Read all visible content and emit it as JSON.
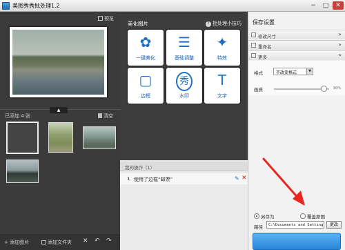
{
  "window": {
    "title": "美图秀秀批处理1.2",
    "min": "−",
    "max": "□",
    "close": "✕"
  },
  "left": {
    "preview_label": "预览",
    "collapse_glyph": "▲",
    "added_count_label": "已添加 4 张",
    "clear_label": "清空",
    "footer": {
      "add_image": "添加图片",
      "add_folder": "添加文件夹",
      "delete_glyph": "✕",
      "undo_glyph": "↶",
      "redo_glyph": "↷"
    }
  },
  "center": {
    "title": "美化图片",
    "tips_label": "批处理小技巧",
    "tips_icon": "?",
    "tiles": [
      {
        "label": "一键美化",
        "glyph": "✿",
        "icon": "flower-icon"
      },
      {
        "label": "基础调整",
        "glyph": "☰",
        "icon": "sliders-icon"
      },
      {
        "label": "特效",
        "glyph": "✦",
        "icon": "magic-wand-icon"
      },
      {
        "label": "边框",
        "glyph": "▢",
        "icon": "frame-icon"
      },
      {
        "label": "水印",
        "glyph": "秀",
        "icon": "watermark-icon"
      },
      {
        "label": "文字",
        "glyph": "T",
        "icon": "text-icon"
      }
    ],
    "ops_header": "我的操作（1）",
    "ops": [
      {
        "num": "1",
        "text": "使用了边框“邮票”",
        "edit_glyph": "✎",
        "delete_glyph": "✕"
      }
    ]
  },
  "right": {
    "title": "保存设置",
    "sections": [
      {
        "label": "修改尺寸",
        "chevron": "»"
      },
      {
        "label": "重命名",
        "chevron": "»"
      },
      {
        "label": "更多",
        "chevron": "«"
      }
    ],
    "format_label": "格式",
    "format_value": "不改变格式",
    "format_arrow": "▼",
    "quality_label": "画质",
    "quality_value_text": "90%",
    "quality_level": 0.9,
    "save_as_label": "另存为",
    "overwrite_label": "覆盖原图",
    "path_label": "路径",
    "path_value": "C:\\Documents and Settings\\",
    "change_label": "更改"
  },
  "colors": {
    "accent": "#2b85d8",
    "annotation": "#e8261e"
  }
}
